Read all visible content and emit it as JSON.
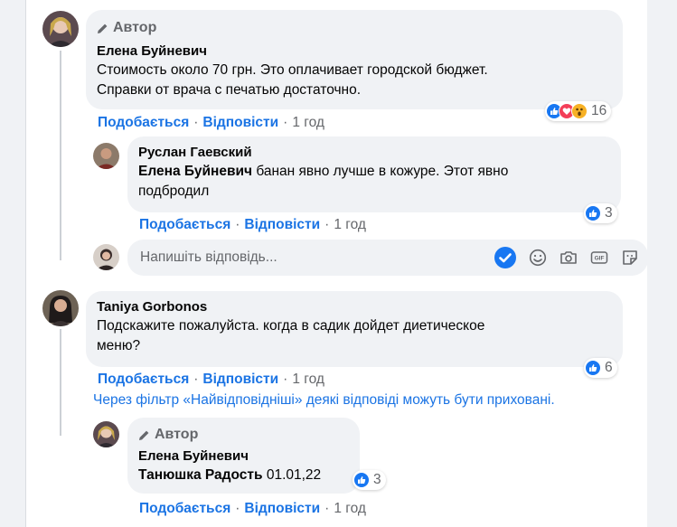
{
  "accent_color": "#1b74e4",
  "comments": [
    {
      "author_badge": "Автор",
      "name": "Елена Буйневич",
      "text_line1": "Стоимость около 70 грн. Это оплачивает городской бюджет.",
      "text_line2": "Справки от врача с печатью достаточно.",
      "actions": {
        "like": "Подобається",
        "reply": "Відповісти",
        "time": "1 год"
      },
      "reactions": {
        "count": "16",
        "types": [
          "like",
          "love",
          "wow"
        ]
      },
      "avatar_icon": "user-avatar"
    },
    {
      "name": "Руслан Гаевский",
      "mention": "Елена Буйневич",
      "text_rest": " банан явно лучше в кожуре. Этот явно",
      "text_line2": "подбродил",
      "actions": {
        "like": "Подобається",
        "reply": "Відповісти",
        "time": "1 год"
      },
      "reactions": {
        "count": "3",
        "types": [
          "like"
        ]
      },
      "avatar_icon": "user-avatar"
    },
    {
      "name": "Taniya Gorbonos",
      "text_line1": "Подскажите пожалуйста. когда в садик дойдет диетическое",
      "text_line2": "меню?",
      "actions": {
        "like": "Подобається",
        "reply": "Відповісти",
        "time": "1 год"
      },
      "reactions": {
        "count": "6",
        "types": [
          "like"
        ]
      },
      "avatar_icon": "user-avatar"
    },
    {
      "author_badge": "Автор",
      "name": "Елена Буйневич",
      "mention": "Танюшка Радость",
      "text_rest": " 01.01,22",
      "actions": {
        "like": "Подобається",
        "reply": "Відповісти",
        "time": "1 год"
      },
      "reactions": {
        "count": "3",
        "types": [
          "like"
        ]
      },
      "avatar_icon": "user-avatar"
    }
  ],
  "reply_box": {
    "placeholder": "Напишіть відповідь...",
    "icons": [
      "verified-check-icon",
      "emoji-icon",
      "camera-icon",
      "gif-icon",
      "sticker-icon"
    ]
  },
  "filter_note": "Через фільтр «Найвідповідніші» деякі відповіді можуть бути приховані."
}
